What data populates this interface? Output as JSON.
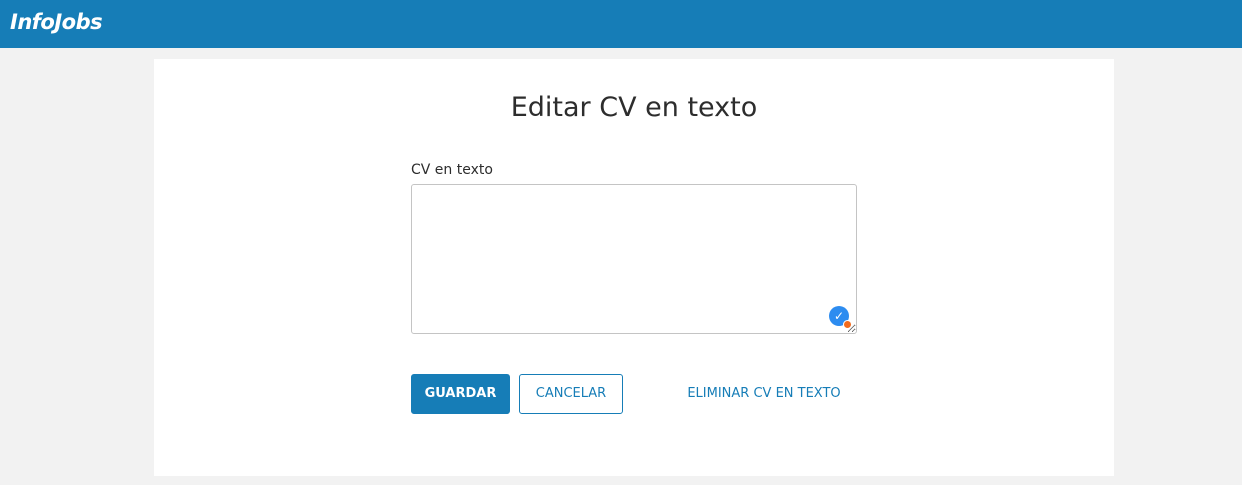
{
  "header": {
    "logo_text": "InfoJobs",
    "bar_color": "#167db7"
  },
  "page": {
    "title": "Editar CV en texto"
  },
  "form": {
    "field_label": "CV en texto",
    "textarea_value": "",
    "spellcheck_icon": "grammar-check-icon"
  },
  "actions": {
    "save_label": "GUARDAR",
    "cancel_label": "CANCELAR",
    "delete_label": "ELIMINAR CV EN TEXTO"
  },
  "colors": {
    "accent": "#167db7",
    "background": "#f2f2f2",
    "card": "#ffffff",
    "text": "#2d2d2d"
  }
}
